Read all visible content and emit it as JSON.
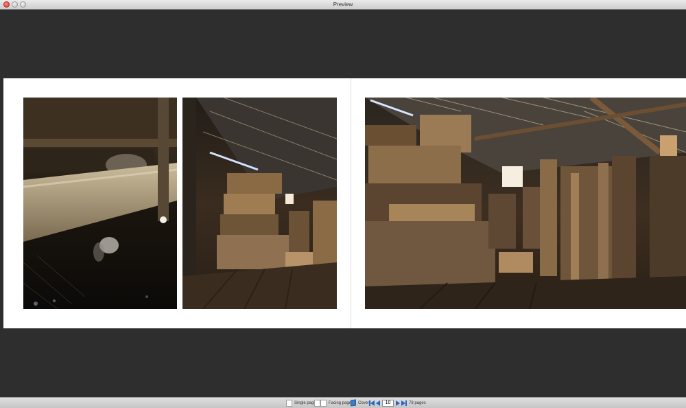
{
  "window": {
    "title": "Preview"
  },
  "toolbar": {
    "single_page_label": "Single page",
    "facing_pages_label": "Facing pages",
    "cover_label": "Cover",
    "page_number": "10",
    "pages_count_label": "78 pages"
  },
  "photos": [
    {
      "name": "photo-logs-spiderweb",
      "desc_icon": "photo"
    },
    {
      "name": "photo-shed-crates-left",
      "desc_icon": "photo"
    },
    {
      "name": "photo-shed-crates-right",
      "desc_icon": "photo"
    }
  ],
  "colors": {
    "canvas": "#2e2e2e",
    "page": "#ffffff",
    "nav_accent": "#2a66c4"
  }
}
